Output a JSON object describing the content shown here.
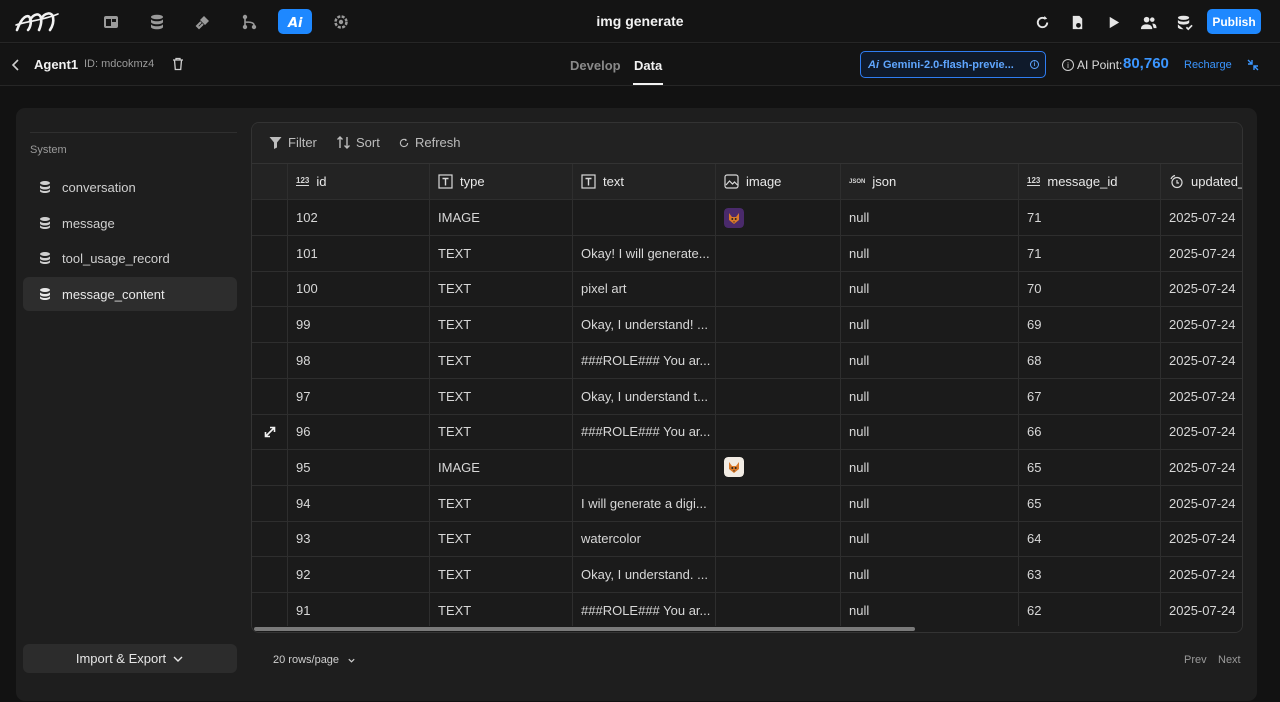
{
  "header": {
    "title": "img generate",
    "publish_label": "Publish",
    "logo_icon": "brand-logo-icon",
    "nav_icons": [
      "pages-icon",
      "database-icon",
      "plugin-icon",
      "workflow-icon",
      "ai-icon",
      "settings-icon"
    ],
    "tool_icons": [
      "refresh-icon",
      "file-settings-icon",
      "play-icon",
      "users-icon",
      "db-check-icon"
    ],
    "accent_color": "#1e88ff"
  },
  "subbar": {
    "agent_name": "Agent1",
    "agent_id": "ID: mdcokmz4",
    "tabs": [
      {
        "label": "Develop",
        "active": false
      },
      {
        "label": "Data",
        "active": true
      }
    ],
    "model": "Gemini-2.0-flash-previe...",
    "ai_point_label": "AI Point:",
    "ai_point_value": "80,760",
    "recharge_label": "Recharge"
  },
  "sidebar": {
    "section_label": "System",
    "items": [
      {
        "label": "conversation",
        "active": false
      },
      {
        "label": "message",
        "active": false
      },
      {
        "label": "tool_usage_record",
        "active": false
      },
      {
        "label": "message_content",
        "active": true
      }
    ],
    "import_export_label": "Import & Export"
  },
  "toolbar": {
    "filter_label": "Filter",
    "sort_label": "Sort",
    "refresh_label": "Refresh"
  },
  "table": {
    "columns": [
      {
        "label": "id",
        "icon": "number-icon"
      },
      {
        "label": "type",
        "icon": "text-type-icon"
      },
      {
        "label": "text",
        "icon": "text-type-icon"
      },
      {
        "label": "image",
        "icon": "image-icon"
      },
      {
        "label": "json",
        "icon": "json-icon"
      },
      {
        "label": "message_id",
        "icon": "number-icon"
      },
      {
        "label": "updated_",
        "icon": "clock-icon"
      }
    ],
    "rows": [
      {
        "id": "102",
        "type": "IMAGE",
        "text": "",
        "image": "fox-thumb-dark",
        "json": "null",
        "message_id": "71",
        "updated": "2025-07-24"
      },
      {
        "id": "101",
        "type": "TEXT",
        "text": "Okay! I will generate...",
        "image": "",
        "json": "null",
        "message_id": "71",
        "updated": "2025-07-24"
      },
      {
        "id": "100",
        "type": "TEXT",
        "text": "pixel art",
        "image": "",
        "json": "null",
        "message_id": "70",
        "updated": "2025-07-24"
      },
      {
        "id": "99",
        "type": "TEXT",
        "text": "Okay, I understand! ...",
        "image": "",
        "json": "null",
        "message_id": "69",
        "updated": "2025-07-24"
      },
      {
        "id": "98",
        "type": "TEXT",
        "text": "###ROLE### You ar...",
        "image": "",
        "json": "null",
        "message_id": "68",
        "updated": "2025-07-24"
      },
      {
        "id": "97",
        "type": "TEXT",
        "text": "Okay, I understand t...",
        "image": "",
        "json": "null",
        "message_id": "67",
        "updated": "2025-07-24"
      },
      {
        "id": "96",
        "type": "TEXT",
        "text": "###ROLE### You ar...",
        "image": "",
        "json": "null",
        "message_id": "66",
        "updated": "2025-07-24",
        "hover": true
      },
      {
        "id": "95",
        "type": "IMAGE",
        "text": "",
        "image": "fox-thumb-light",
        "json": "null",
        "message_id": "65",
        "updated": "2025-07-24"
      },
      {
        "id": "94",
        "type": "TEXT",
        "text": "I will generate a digi...",
        "image": "",
        "json": "null",
        "message_id": "65",
        "updated": "2025-07-24"
      },
      {
        "id": "93",
        "type": "TEXT",
        "text": "watercolor",
        "image": "",
        "json": "null",
        "message_id": "64",
        "updated": "2025-07-24"
      },
      {
        "id": "92",
        "type": "TEXT",
        "text": "Okay, I understand. ...",
        "image": "",
        "json": "null",
        "message_id": "63",
        "updated": "2025-07-24"
      },
      {
        "id": "91",
        "type": "TEXT",
        "text": "###ROLE### You ar...",
        "image": "",
        "json": "null",
        "message_id": "62",
        "updated": "2025-07-24"
      }
    ]
  },
  "footer": {
    "rows_per_page": "20 rows/page",
    "prev_label": "Prev",
    "next_label": "Next"
  }
}
